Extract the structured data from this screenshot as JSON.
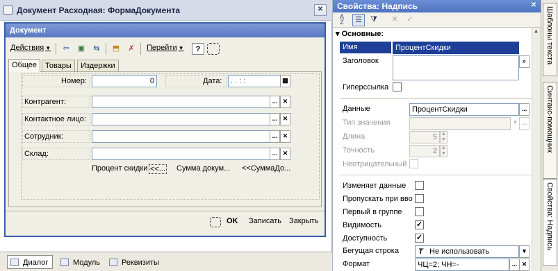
{
  "designer": {
    "title": "Документ Расходная: ФормаДокумента"
  },
  "form": {
    "title": "Документ",
    "toolbar": {
      "actions_label": "Действия",
      "goto_label": "Перейти",
      "help_label": "?"
    },
    "tabs": [
      {
        "label": "Общее",
        "active": true
      },
      {
        "label": "Товары",
        "active": false
      },
      {
        "label": "Издержки",
        "active": false
      }
    ],
    "number_label": "Номер:",
    "number_value": "0",
    "date_label": "Дата:",
    "date_value": ". .   : :",
    "fields": [
      {
        "label": "Контрагент:",
        "value": ""
      },
      {
        "label": "Контактное лицо:",
        "value": ""
      },
      {
        "label": "Сотрудник:",
        "value": ""
      },
      {
        "label": "Склад:",
        "value": ""
      }
    ],
    "footer_texts": {
      "discount": "Процент скидки",
      "discount_tag": "<<...",
      "sum": "Сумма докум...",
      "sum_tag": "<<СуммаДо..."
    },
    "buttons": {
      "ok": "OK",
      "save": "Записать",
      "close": "Закрыть"
    }
  },
  "bottom_tabs": [
    {
      "label": "Диалог",
      "active": true
    },
    {
      "label": "Модуль",
      "active": false
    },
    {
      "label": "Реквизиты",
      "active": false
    }
  ],
  "props": {
    "title": "Свойства: Надпись",
    "section": "Основные:",
    "rows": {
      "name_label": "Имя",
      "name_value": "ПроцентСкидки",
      "caption_label": "Заголовок",
      "hyperlink_label": "Гиперссылка",
      "data_label": "Данные",
      "data_value": "ПроцентСкидки",
      "type_label": "Тип значения",
      "length_label": "Длина",
      "length_value": "5",
      "precision_label": "Точность",
      "precision_value": "2",
      "nonneg_label": "Неотрицательный",
      "changes_label": "Изменяет данные",
      "skip_label": "Пропускать при вво",
      "first_label": "Первый в группе",
      "visible_label": "Видимость",
      "enabled_label": "Доступность",
      "marquee_label": "Бегущая строка",
      "marquee_value": "Не использовать",
      "format_label": "Формат",
      "format_value": "ЧЦ=2; ЧН=-"
    }
  },
  "side_tabs": [
    {
      "label": "Шаблоны текста"
    },
    {
      "label": "Синтакс-помощник"
    },
    {
      "label": "Свойства: Надпись"
    }
  ]
}
